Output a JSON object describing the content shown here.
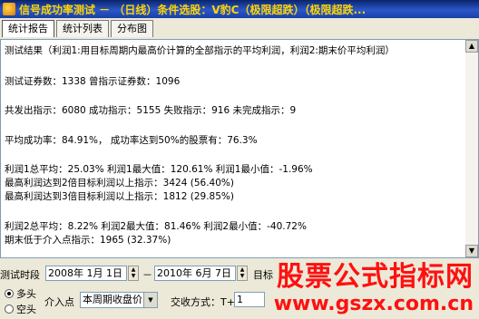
{
  "window": {
    "title": "信号成功率测试 － （日线）条件选股：V豹C（极限超跌）（极限超跌..."
  },
  "tabs": [
    {
      "label": "统计报告"
    },
    {
      "label": "统计列表"
    },
    {
      "label": "分布图"
    }
  ],
  "report": {
    "lines": [
      "测试结果（利润1:用目标周期内最高价计算的全部指示的平均利润，利润2:期末价平均利润）",
      "测试证券数：1338          曾指示证券数：1096",
      "共发出指示：6080   成功指示：5155   失败指示：916   未完成指示：9",
      "平均成功率：84.91%， 成功率达到50%的股票有：76.3%",
      "利润1总平均：25.03%   利润1最大值：120.61%   利润1最小值：-1.96%",
      "最高利润达到2倍目标利润以上指示：3424 (56.40%)",
      "最高利润达到3倍目标利润以上指示：1812 (29.85%)",
      "利润2总平均：8.22%   利润2最大值：81.46%   利润2最小值：-40.72%",
      "期末低于介入点指示：1965 (32.37%)"
    ]
  },
  "controls": {
    "period_label": "测试时段",
    "start_date": "2008年 1月 1日",
    "dash": "－",
    "end_date": "2010年 6月 7日",
    "target_label": "目标",
    "radio_long": "多头",
    "radio_short": "空头",
    "entry_label": "介入点",
    "entry_value": "本周期收盘价",
    "trade_label": "交收方式：T+",
    "trade_value": "1"
  },
  "watermark": {
    "text": "股票公式指标网",
    "url": "www.gszx.com.cn"
  },
  "colors": {
    "titlebar": "#0a246a",
    "title_text": "#ffd400",
    "watermark": "#ff1010"
  },
  "icons": {
    "app": "app-icon",
    "scroll_up": "scroll-up-icon",
    "scroll_down": "scroll-down-icon"
  }
}
